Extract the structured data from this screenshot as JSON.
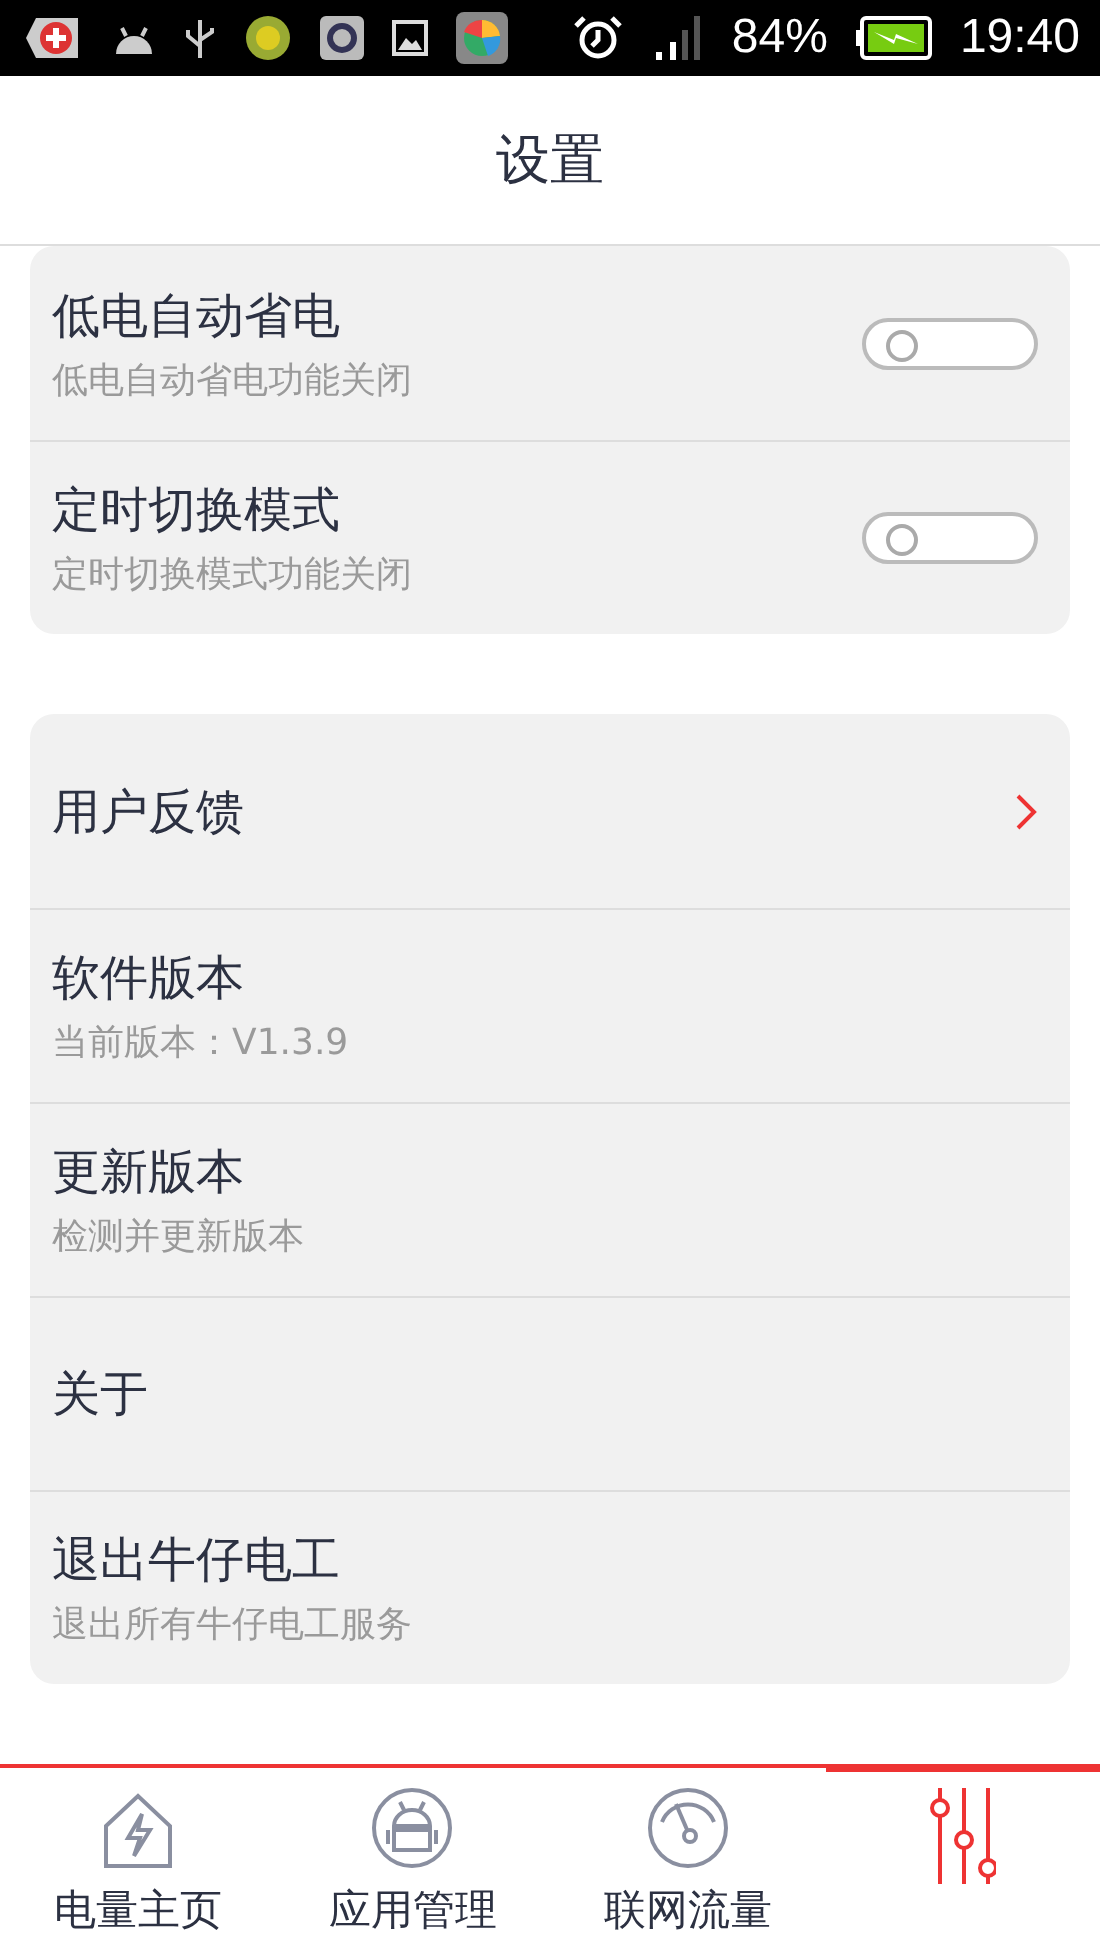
{
  "status_bar": {
    "battery": "84%",
    "time": "19:40"
  },
  "header": {
    "title": "设置"
  },
  "cards": [
    {
      "rows": [
        {
          "kind": "switch",
          "title": "低电自动省电",
          "subtitle": "低电自动省电功能关闭",
          "on": false
        },
        {
          "kind": "switch",
          "title": "定时切换模式",
          "subtitle": "定时切换模式功能关闭",
          "on": false
        }
      ]
    },
    {
      "rows": [
        {
          "kind": "link",
          "title": "用户反馈"
        },
        {
          "kind": "plain",
          "title": "软件版本",
          "subtitle": "当前版本：V1.3.9"
        },
        {
          "kind": "plain",
          "title": "更新版本",
          "subtitle": "检测并更新版本"
        },
        {
          "kind": "plain",
          "title": "关于"
        },
        {
          "kind": "plain",
          "title": "退出牛仔电工",
          "subtitle": "退出所有牛仔电工服务"
        }
      ]
    }
  ],
  "bottom_nav": [
    {
      "kind": "home",
      "label": "电量主页",
      "selected": false
    },
    {
      "kind": "apps",
      "label": "应用管理",
      "selected": false
    },
    {
      "kind": "traffic",
      "label": "联网流量",
      "selected": false
    },
    {
      "kind": "settings",
      "selected": true
    }
  ]
}
